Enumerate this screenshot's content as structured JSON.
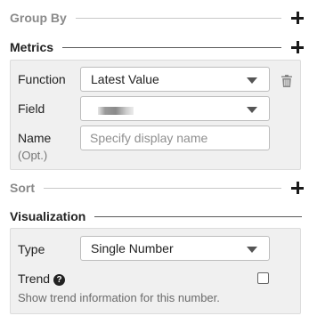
{
  "group_by": {
    "title": "Group By"
  },
  "metrics": {
    "title": "Metrics",
    "function_label": "Function",
    "function_value": "Latest Value",
    "field_label": "Field",
    "field_value": "",
    "name_label": "Name",
    "name_sub": "(Opt.)",
    "name_placeholder": "Specify display name"
  },
  "sort": {
    "title": "Sort"
  },
  "visualization": {
    "title": "Visualization",
    "type_label": "Type",
    "type_value": "Single Number",
    "trend_label": "Trend",
    "trend_help_icon": "?",
    "trend_checked": false,
    "trend_description": "Show trend information for this number."
  },
  "icons": {
    "add": "plus-icon",
    "delete": "trash-icon",
    "dropdown": "caret-down-icon",
    "help": "question-circle-icon"
  },
  "colors": {
    "panel_bg": "#f0f0f0",
    "muted_heading": "#8a8a8a"
  }
}
